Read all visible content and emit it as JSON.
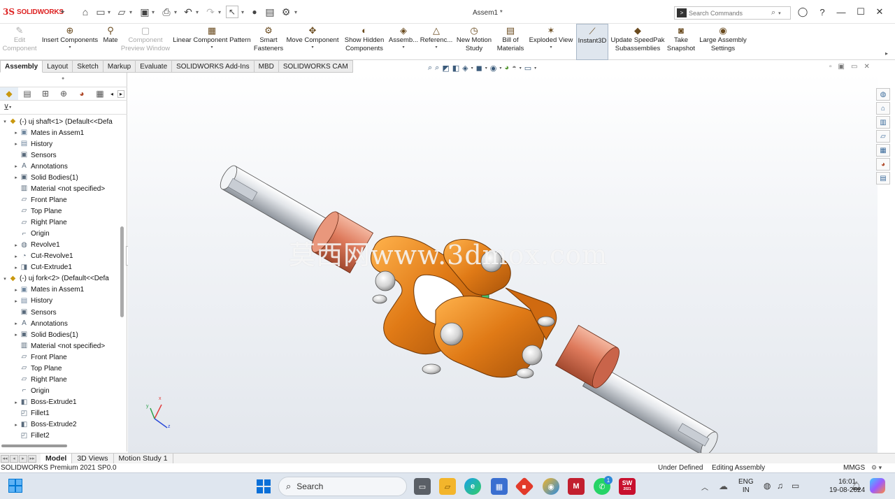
{
  "window": {
    "app_brand": "SOLIDWORKS",
    "logo_mark": "3S",
    "doc_title": "Assem1 *",
    "search_placeholder": "Search Commands"
  },
  "command_manager": {
    "items": [
      {
        "line1": "Edit",
        "line2": "Component",
        "icon": "edit-component-icon",
        "disabled": true
      },
      {
        "line1": "Insert Components",
        "line2": "",
        "icon": "insert-components-icon",
        "dropdown": true
      },
      {
        "line1": "Mate",
        "line2": "",
        "icon": "mate-icon"
      },
      {
        "line1": "Component",
        "line2": "Preview Window",
        "icon": "preview-window-icon",
        "disabled": true
      },
      {
        "line1": "Linear Component Pattern",
        "line2": "",
        "icon": "linear-pattern-icon",
        "dropdown": true
      },
      {
        "line1": "Smart",
        "line2": "Fasteners",
        "icon": "smart-fasteners-icon"
      },
      {
        "line1": "Move Component",
        "line2": "",
        "icon": "move-component-icon",
        "dropdown": true
      },
      {
        "line1": "Show Hidden",
        "line2": "Components",
        "icon": "show-hidden-icon"
      },
      {
        "line1": "Assemb...",
        "line2": "",
        "icon": "assembly-features-icon",
        "dropdown": true
      },
      {
        "line1": "Referenc...",
        "line2": "",
        "icon": "reference-geometry-icon",
        "dropdown": true
      },
      {
        "line1": "New Motion",
        "line2": "Study",
        "icon": "motion-study-icon"
      },
      {
        "line1": "Bill of",
        "line2": "Materials",
        "icon": "bom-icon"
      },
      {
        "line1": "Exploded View",
        "line2": "",
        "icon": "exploded-view-icon",
        "dropdown": true
      },
      {
        "line1": "Instant3D",
        "line2": "",
        "icon": "instant3d-icon",
        "active": true
      },
      {
        "line1": "Update SpeedPak",
        "line2": "Subassemblies",
        "icon": "speedpak-icon"
      },
      {
        "line1": "Take",
        "line2": "Snapshot",
        "icon": "snapshot-icon"
      },
      {
        "line1": "Large Assembly",
        "line2": "Settings",
        "icon": "large-assembly-icon"
      }
    ]
  },
  "tabs": [
    {
      "label": "Assembly",
      "active": true
    },
    {
      "label": "Layout"
    },
    {
      "label": "Sketch"
    },
    {
      "label": "Markup"
    },
    {
      "label": "Evaluate"
    },
    {
      "label": "SOLIDWORKS Add-Ins"
    },
    {
      "label": "MBD"
    },
    {
      "label": "SOLIDWORKS CAM"
    }
  ],
  "feature_tree": {
    "nodes": [
      {
        "label": "(-) uj shaft<1> (Default<<Defa",
        "icon": "part-icon",
        "level": 0,
        "expander": "▾"
      },
      {
        "label": "Mates in Assem1",
        "icon": "mates-folder-icon",
        "level": 1,
        "expander": "▸"
      },
      {
        "label": "History",
        "icon": "history-icon",
        "level": 1,
        "expander": "▸"
      },
      {
        "label": "Sensors",
        "icon": "sensors-icon",
        "level": 1,
        "expander": ""
      },
      {
        "label": "Annotations",
        "icon": "annotations-icon",
        "level": 1,
        "expander": "▸"
      },
      {
        "label": "Solid Bodies(1)",
        "icon": "solid-bodies-icon",
        "level": 1,
        "expander": "▸"
      },
      {
        "label": "Material <not specified>",
        "icon": "material-icon",
        "level": 1,
        "expander": ""
      },
      {
        "label": "Front Plane",
        "icon": "plane-icon",
        "level": 1,
        "expander": ""
      },
      {
        "label": "Top Plane",
        "icon": "plane-icon",
        "level": 1,
        "expander": ""
      },
      {
        "label": "Right Plane",
        "icon": "plane-icon",
        "level": 1,
        "expander": ""
      },
      {
        "label": "Origin",
        "icon": "origin-icon",
        "level": 1,
        "expander": ""
      },
      {
        "label": "Revolve1",
        "icon": "revolve-icon",
        "level": 1,
        "expander": "▸"
      },
      {
        "label": "Cut-Revolve1",
        "icon": "cut-revolve-icon",
        "level": 1,
        "expander": "▸"
      },
      {
        "label": "Cut-Extrude1",
        "icon": "cut-extrude-icon",
        "level": 1,
        "expander": "▸"
      },
      {
        "label": "(-) uj fork<2> (Default<<Defa",
        "icon": "part-icon",
        "level": 0,
        "expander": "▾"
      },
      {
        "label": "Mates in Assem1",
        "icon": "mates-folder-icon",
        "level": 1,
        "expander": "▸"
      },
      {
        "label": "History",
        "icon": "history-icon",
        "level": 1,
        "expander": "▸"
      },
      {
        "label": "Sensors",
        "icon": "sensors-icon",
        "level": 1,
        "expander": ""
      },
      {
        "label": "Annotations",
        "icon": "annotations-icon",
        "level": 1,
        "expander": "▸"
      },
      {
        "label": "Solid Bodies(1)",
        "icon": "solid-bodies-icon",
        "level": 1,
        "expander": "▸"
      },
      {
        "label": "Material <not specified>",
        "icon": "material-icon",
        "level": 1,
        "expander": ""
      },
      {
        "label": "Front Plane",
        "icon": "plane-icon",
        "level": 1,
        "expander": ""
      },
      {
        "label": "Top Plane",
        "icon": "plane-icon",
        "level": 1,
        "expander": ""
      },
      {
        "label": "Right Plane",
        "icon": "plane-icon",
        "level": 1,
        "expander": ""
      },
      {
        "label": "Origin",
        "icon": "origin-icon",
        "level": 1,
        "expander": ""
      },
      {
        "label": "Boss-Extrude1",
        "icon": "boss-extrude-icon",
        "level": 1,
        "expander": "▸"
      },
      {
        "label": "Fillet1",
        "icon": "fillet-icon",
        "level": 1,
        "expander": ""
      },
      {
        "label": "Boss-Extrude2",
        "icon": "boss-extrude-icon",
        "level": 1,
        "expander": "▸"
      },
      {
        "label": "Fillet2",
        "icon": "fillet-icon",
        "level": 1,
        "expander": ""
      }
    ]
  },
  "viewport": {
    "watermark": "莫西网www.3dmox.com",
    "triad": {
      "x": "x",
      "y": "y",
      "z": "z"
    },
    "colors": {
      "fork": "#e07a16",
      "collar": "#d9725a",
      "shaft": "#cfd3d8",
      "spider": "#48c46a"
    }
  },
  "bottom_tabs": [
    {
      "label": "Model",
      "active": true
    },
    {
      "label": "3D Views"
    },
    {
      "label": "Motion Study 1"
    }
  ],
  "status": {
    "app": "SOLIDWORKS Premium 2021 SP0.0",
    "definition": "Under Defined",
    "editing": "Editing Assembly",
    "units": "MMGS"
  },
  "taskbar": {
    "search": "Search",
    "lang1": "ENG",
    "lang2": "IN",
    "time": "16:01",
    "date": "19-08-2024",
    "whatsapp_badge": "1",
    "sw_label": "SW",
    "sw_sub": "2021"
  }
}
